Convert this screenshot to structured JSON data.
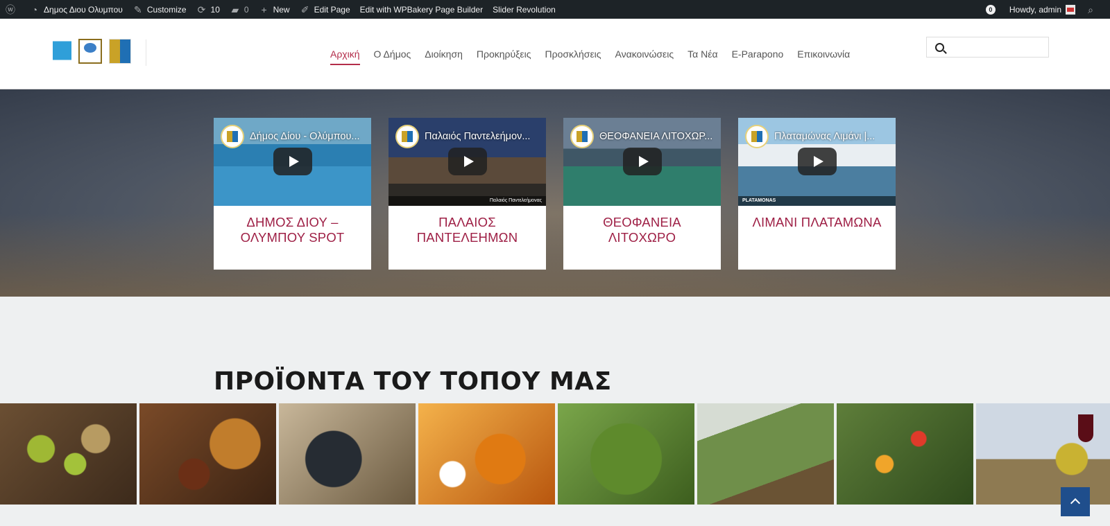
{
  "adminbar": {
    "site_name": "Δημος Διου Ολυμπου",
    "customize": "Customize",
    "updates_count": "10",
    "comments_count": "0",
    "new_label": "New",
    "edit_page": "Edit Page",
    "wpbakery": "Edit with WPBakery Page Builder",
    "slider": "Slider Revolution",
    "notifications": "0",
    "howdy": "Howdy, admin"
  },
  "nav": {
    "items": [
      "Αρχική",
      "Ο Δήμος",
      "Διοίκηση",
      "Προκηρύξεις",
      "Προσκλήσεις",
      "Ανακοινώσεις",
      "Τα Νέα",
      "E-Paraponο",
      "Επικοινωνία"
    ]
  },
  "search": {
    "placeholder": ""
  },
  "videos": [
    {
      "title": "Δήμος Δίου - Ολύμπου...",
      "caption": "ΔΗΜΟΣ ΔΙΟΥ – ΟΛΥΜΠΟΥ SPOT",
      "strip": ""
    },
    {
      "title": "Παλαιός Παντελεήμον...",
      "caption": "ΠΑΛΑΙΟΣ ΠΑΝΤΕΛΕΗΜΩΝ",
      "strip": "Παλαιός Παντελεήμονας"
    },
    {
      "title": "ΘΕΟΦΑΝΕΙΑ ΛΙΤΟΧΩΡ...",
      "caption": "ΘΕΟΦΑΝΕΙΑ ΛΙΤΟΧΩΡΟ",
      "strip": ""
    },
    {
      "title": "Πλαταμώνας Λιμάνι |...",
      "caption": "ΛΙΜΑΝΙ ΠΛΑΤΑΜΩΝΑ",
      "strip": "PLATAMONAS"
    }
  ],
  "products": {
    "title": "ΠΡΟΪΟΝΤΑ ΤΟΥ ΤΟΠΟΥ ΜΑΣ"
  },
  "colors": {
    "accent": "#b32d4a",
    "admin_bg": "#1d2327",
    "to_top": "#1f4e8c"
  }
}
